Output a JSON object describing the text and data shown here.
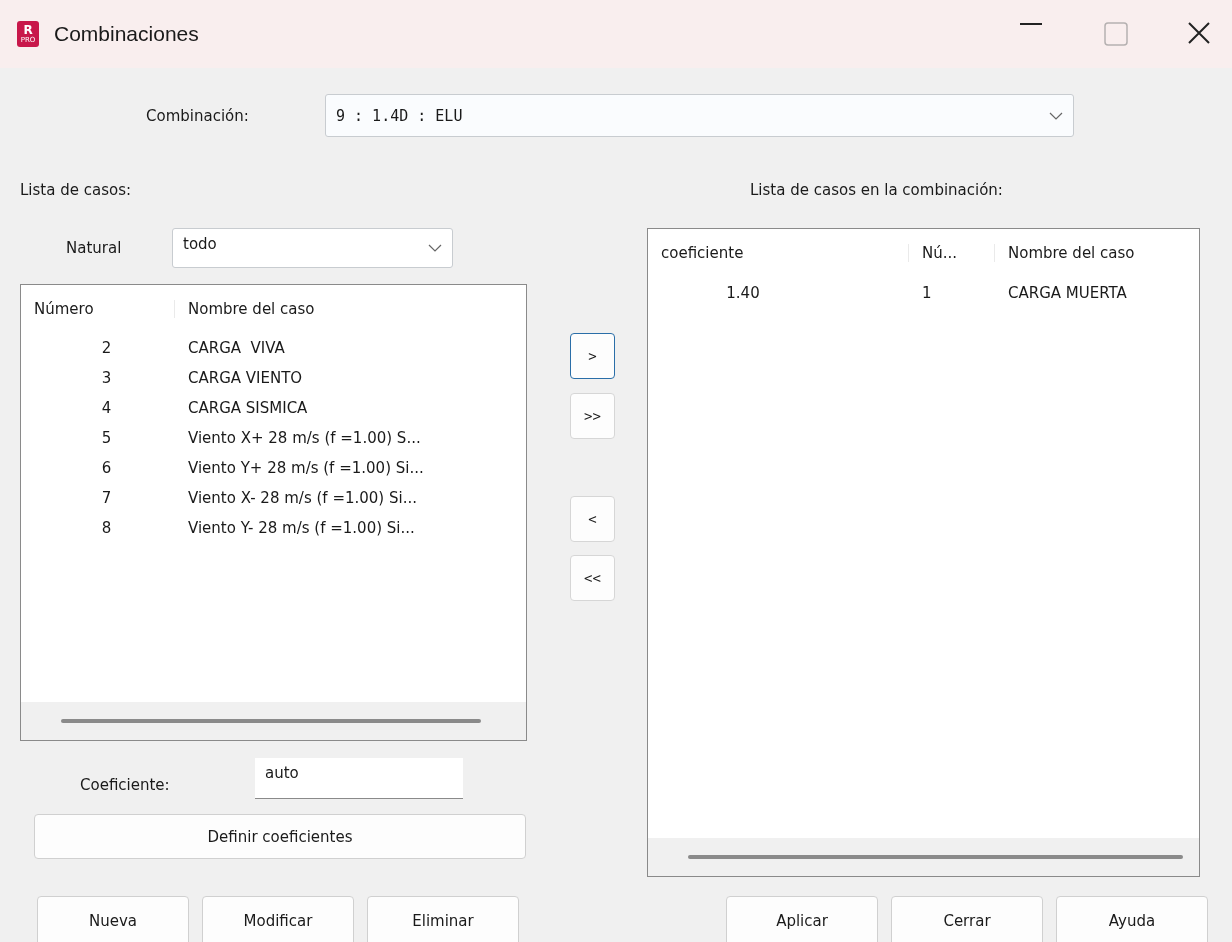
{
  "window": {
    "title": "Combinaciones",
    "app_icon": {
      "letter": "R",
      "sub": "PRO"
    }
  },
  "combination": {
    "label": "Combinación:",
    "value": "9 : 1.4D : ELU"
  },
  "cases": {
    "label": "Lista de casos:",
    "filter_label": "Natural",
    "filter_value": "todo",
    "columns": [
      "Número",
      "Nombre del caso"
    ],
    "rows": [
      {
        "number": "2",
        "name": "CARGA  VIVA"
      },
      {
        "number": "3",
        "name": "CARGA VIENTO"
      },
      {
        "number": "4",
        "name": "CARGA SISMICA"
      },
      {
        "number": "5",
        "name": "Viento X+ 28 m/s (f =1.00) S..."
      },
      {
        "number": "6",
        "name": "Viento Y+ 28 m/s (f =1.00) Si..."
      },
      {
        "number": "7",
        "name": "Viento X- 28 m/s (f =1.00) Si..."
      },
      {
        "number": "8",
        "name": "Viento Y- 28 m/s (f =1.00) Si..."
      }
    ],
    "coef_label": "Coeficiente:",
    "coef_value": "auto",
    "define_button": "Definir coeficientes"
  },
  "move_buttons": [
    {
      "label": ">",
      "focused": true
    },
    {
      "label": ">>",
      "focused": false
    },
    {
      "label": "<",
      "focused": false
    },
    {
      "label": "<<",
      "focused": false
    }
  ],
  "combination_cases": {
    "label": "Lista de casos en la combinación:",
    "columns": [
      "coeficiente",
      "Nú...",
      "Nombre del caso"
    ],
    "rows": [
      {
        "coefficient": "1.40",
        "number": "1",
        "name": "CARGA MUERTA"
      }
    ]
  },
  "left_buttons": [
    "Nueva",
    "Modificar",
    "Eliminar"
  ],
  "right_buttons": [
    "Aplicar",
    "Cerrar",
    "Ayuda"
  ]
}
